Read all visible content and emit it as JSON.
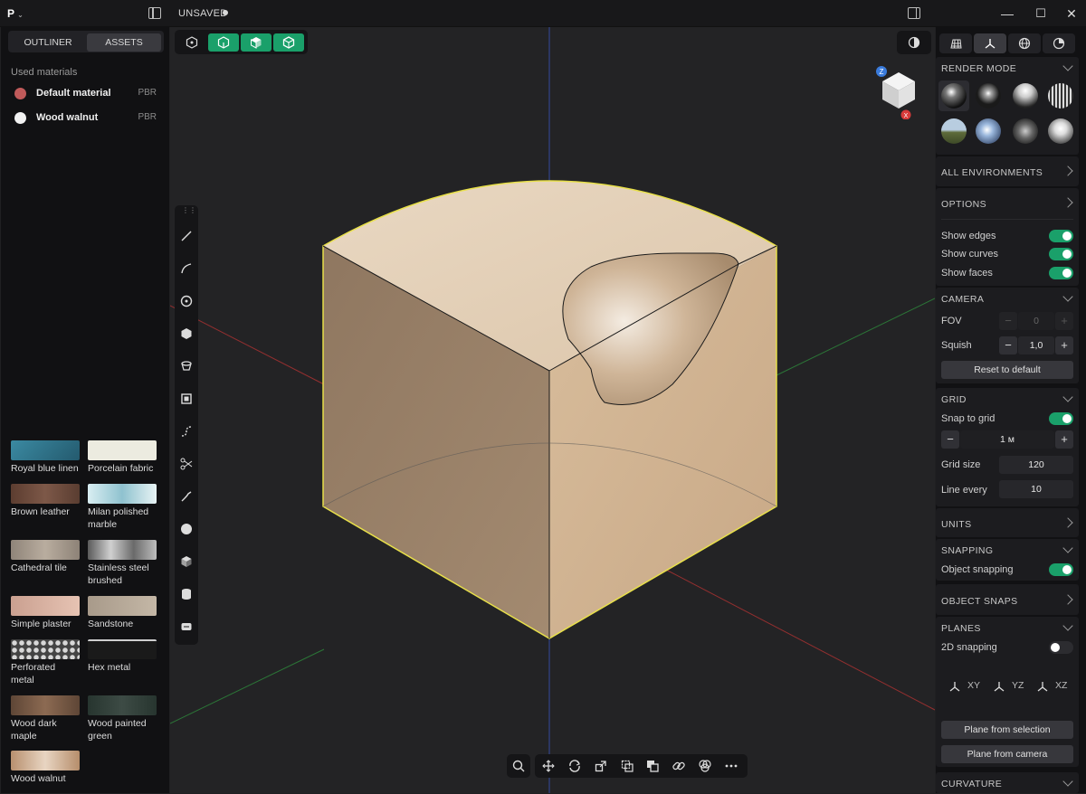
{
  "titlebar": {
    "logo": "P",
    "doc_title": "UNSAVED",
    "minimize": "—",
    "maximize": "☐",
    "close": "✕"
  },
  "sidebar": {
    "tabs": [
      {
        "label": "OUTLINER",
        "active": false
      },
      {
        "label": "ASSETS",
        "active": true
      }
    ],
    "used_materials_label": "Used materials",
    "used_materials": [
      {
        "name": "Default material",
        "kind": "PBR",
        "color": "#c05a5a"
      },
      {
        "name": "Wood walnut",
        "kind": "PBR",
        "color": "#f2f2f2"
      }
    ],
    "assets": [
      {
        "name": "Royal blue linen",
        "color": "#2f6f86"
      },
      {
        "name": "Porcelain fabric",
        "color": "#ecebe0"
      },
      {
        "name": "Brown leather",
        "color": "#6b4a3c"
      },
      {
        "name": "Milan polished marble",
        "color": "#b9d6dd"
      },
      {
        "name": "Cathedral tile",
        "color": "#a89a8c"
      },
      {
        "name": "Stainless steel brushed",
        "color": "#9b9b9b"
      },
      {
        "name": "Simple plaster",
        "color": "#d8b4a3"
      },
      {
        "name": "Sandstone",
        "color": "#b8aa98"
      },
      {
        "name": "Perforated metal",
        "color": "#5a5a5a"
      },
      {
        "name": "Hex metal",
        "color": "#222222"
      },
      {
        "name": "Wood dark maple",
        "color": "#6e5441"
      },
      {
        "name": "Wood painted green",
        "color": "#2c3a34"
      },
      {
        "name": "Wood walnut",
        "color": "#c9a98a"
      }
    ]
  },
  "viewport": {
    "viewcube_labels": {
      "z": "Z",
      "x": "X"
    }
  },
  "right_panel": {
    "render_mode": {
      "title": "RENDER MODE"
    },
    "all_environments": "ALL ENVIRONMENTS",
    "options": {
      "title": "OPTIONS",
      "show_edges": {
        "label": "Show edges",
        "on": true
      },
      "show_curves": {
        "label": "Show curves",
        "on": true
      },
      "show_faces": {
        "label": "Show faces",
        "on": true
      }
    },
    "camera": {
      "title": "CAMERA",
      "fov_label": "FOV",
      "fov_value": "0",
      "squish_label": "Squish",
      "squish_value": "1,0",
      "reset_label": "Reset to default"
    },
    "grid": {
      "title": "GRID",
      "snap_label": "Snap to grid",
      "snap_on": true,
      "step_value": "1 м",
      "size_label": "Grid size",
      "size_value": "120",
      "line_every_label": "Line every",
      "line_every_value": "10"
    },
    "units": "UNITS",
    "snapping": {
      "title": "SNAPPING",
      "object_snapping_label": "Object snapping",
      "object_snapping_on": true
    },
    "object_snaps": "OBJECT SNAPS",
    "planes": {
      "title": "PLANES",
      "snapping_2d_label": "2D snapping",
      "snapping_2d_on": false,
      "xy": "XY",
      "yz": "YZ",
      "xz": "XZ",
      "from_selection": "Plane from selection",
      "from_camera": "Plane from camera"
    },
    "curvature": "CURVATURE"
  },
  "colors": {
    "accent": "#1aa06a",
    "selection": "#e8e04a"
  }
}
